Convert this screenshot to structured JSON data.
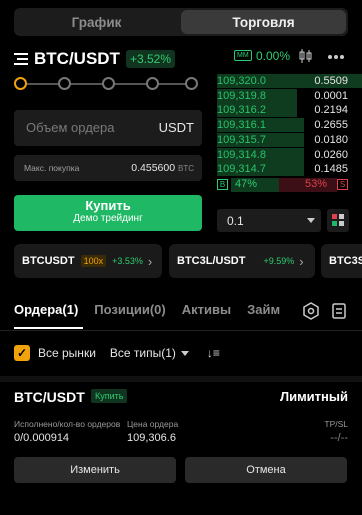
{
  "tabs": [
    {
      "label": "График"
    },
    {
      "label": "Торговля"
    }
  ],
  "pair": {
    "name": "BTC/USDT",
    "change": "+3.52%"
  },
  "market_maker": {
    "badge": "MM",
    "value": "0.00%"
  },
  "form": {
    "order_placeholder": "Объем ордера",
    "unit": "USDT",
    "max_buy_label": "Макс. покупка",
    "max_buy_value": "0.455600",
    "max_buy_currency": "BTC",
    "buy_label": "Купить",
    "buy_sub": "Демо трейдинг",
    "slider_percent": 0
  },
  "orderbook": {
    "bids": [
      {
        "price": "109,320.0",
        "qty": "0.5509",
        "depth": 1.0
      },
      {
        "price": "109,319.8",
        "qty": "0.0001",
        "depth": 0.55
      },
      {
        "price": "109,316.2",
        "qty": "0.2194",
        "depth": 0.55
      },
      {
        "price": "109,316.1",
        "qty": "0.2655",
        "depth": 0.6
      },
      {
        "price": "109,315.7",
        "qty": "0.0180",
        "depth": 0.6
      },
      {
        "price": "109,314.8",
        "qty": "0.0260",
        "depth": 0.6
      },
      {
        "price": "109,314.7",
        "qty": "0.1485",
        "depth": 0.6
      }
    ],
    "buy_badge": "B",
    "buy_pct": "47%",
    "sell_pct": "53%",
    "sell_badge": "S",
    "precision": "0.1"
  },
  "tickers": [
    {
      "name": "BTCUSDT",
      "leverage": "100x",
      "change": "+3.53%"
    },
    {
      "name": "BTC3L/USDT",
      "change": "+9.59%"
    },
    {
      "name": "BTC3S"
    }
  ],
  "bottom_tabs": [
    {
      "label": "Ордера(1)"
    },
    {
      "label": "Позиции(0)"
    },
    {
      "label": "Активы"
    },
    {
      "label": "Займ"
    }
  ],
  "filters": {
    "all_markets": "Все рынки",
    "all_types": "Все типы(1)"
  },
  "order": {
    "pair": "BTC/USDT",
    "side": "Купить",
    "type": "Лимитный",
    "filled_label": "Исполнено/кол-во ордеров",
    "filled_value": "0/0.000914",
    "price_label": "Цена ордера",
    "price_value": "109,306.6",
    "tpsl_label": "TP/SL",
    "tpsl_value": "--/--",
    "edit_label": "Изменить",
    "cancel_label": "Отмена"
  },
  "colors": {
    "accent": "#f0a30a",
    "buy": "#1fb864",
    "sell": "#e0404c"
  }
}
